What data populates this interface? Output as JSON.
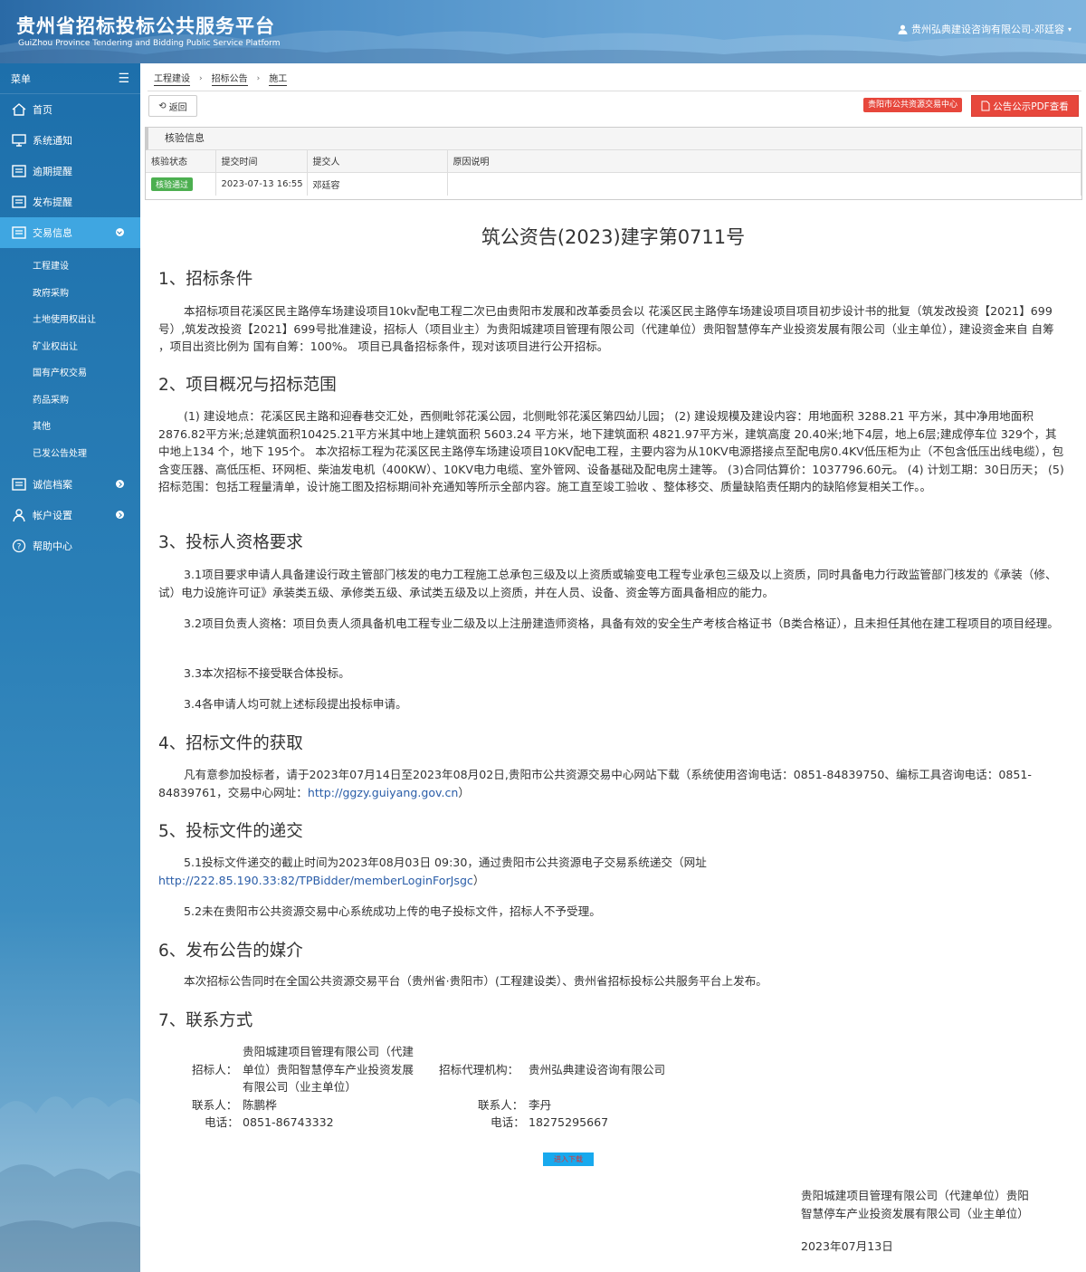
{
  "header": {
    "title": "贵州省招标投标公共服务平台",
    "subtitle": "GuiZhou Province Tendering and Bidding Public Service Platform",
    "user": "贵州弘典建设咨询有限公司-邓廷容"
  },
  "sidebar": {
    "menu_label": "菜单",
    "items": [
      {
        "label": "首页",
        "icon": "home-icon"
      },
      {
        "label": "系统通知",
        "icon": "monitor-icon"
      },
      {
        "label": "逾期提醒",
        "icon": "list-icon"
      },
      {
        "label": "发布提醒",
        "icon": "list-icon"
      },
      {
        "label": "交易信息",
        "icon": "list-icon"
      },
      {
        "label": "诚信档案",
        "icon": "list-icon"
      },
      {
        "label": "帐户设置",
        "icon": "user-icon"
      },
      {
        "label": "帮助中心",
        "icon": "help-icon"
      }
    ],
    "subitems": [
      "工程建设",
      "政府采购",
      "土地使用权出让",
      "矿业权出让",
      "国有产权交易",
      "药品采购",
      "其他",
      "已发公告处理"
    ]
  },
  "breadcrumb": [
    "工程建设",
    "招标公告",
    "施工"
  ],
  "toolbar": {
    "back_label": "返回",
    "center_badge": "贵阳市公共资源交易中心",
    "pdf_label": "公告公示PDF查看"
  },
  "verify": {
    "title": "核验信息",
    "headers": [
      "核验状态",
      "提交时间",
      "提交人",
      "原因说明"
    ],
    "status": "核验通过",
    "time": "2023-07-13 16:55",
    "submitter": "邓廷容",
    "reason": ""
  },
  "doc": {
    "title": "筑公资告(2023)建字第0711号",
    "s1_title": "1、招标条件",
    "s1_p": "本招标项目花溪区民主路停车场建设项目10kv配电工程二次已由贵阳市发展和改革委员会以 花溪区民主路停车场建设项目项目初步设计书的批复（筑发改投资【2021】699号）,筑发改投资【2021】699号批准建设，招标人（项目业主）为贵阳城建项目管理有限公司（代建单位）贵阳智慧停车产业投资发展有限公司（业主单位），建设资金来自 自筹 ，项目出资比例为 国有自筹：100%。 项目已具备招标条件，现对该项目进行公开招标。",
    "s2_title": "2、项目概况与招标范围",
    "s2_p": "(1) 建设地点：花溪区民主路和迎春巷交汇处，西侧毗邻花溪公园，北侧毗邻花溪区第四幼儿园； (2) 建设规模及建设内容：用地面积 3288.21 平方米，其中净用地面积2876.82平方米;总建筑面积10425.21平方米其中地上建筑面积 5603.24 平方米，地下建筑面积 4821.97平方米，建筑高度 20.40米;地下4层，地上6层;建成停车位 329个，其中地上134 个，地下 195个。 本次招标工程为花溪区民主路停车场建设项目10KV配电工程，主要内容为从10KV电源搭接点至配电房0.4KV低压柜为止（不包含低压出线电缆），包含变压器、高低压柜、环网柜、柴油发电机（400KW）、10KV电力电缆、室外管网、设备基础及配电房土建等。 (3)合同估算价：1037796.60元。 (4) 计划工期：30日历天； (5)招标范围：包括工程量清单，设计施工图及招标期间补充通知等所示全部内容。施工直至竣工验收 、整体移交、质量缺陷责任期内的缺陷修复相关工作。。",
    "s3_title": "3、投标人资格要求",
    "s3_p1": "3.1项目要求申请人具备建设行政主管部门核发的电力工程施工总承包三级及以上资质或输变电工程专业承包三级及以上资质，同时具备电力行政监管部门核发的《承装（修、试）电力设施许可证》承装类五级、承修类五级、承试类五级及以上资质，并在人员、设备、资金等方面具备相应的能力。",
    "s3_p2": "3.2项目负责人资格：项目负责人须具备机电工程专业二级及以上注册建造师资格，具备有效的安全生产考核合格证书（B类合格证），且未担任其他在建工程项目的项目经理。",
    "s3_p3": "3.3本次招标不接受联合体投标。",
    "s3_p4": "3.4各申请人均可就上述标段提出投标申请。",
    "s4_title": "4、招标文件的获取",
    "s4_p": "凡有意参加投标者，请于2023年07月14日至2023年08月02日,贵阳市公共资源交易中心网站下载（系统使用咨询电话：0851-84839750、编标工具咨询电话：0851-84839761，交易中心网址：",
    "s4_link": "http://ggzy.guiyang.gov.cn",
    "s4_tail": "）",
    "s5_title": "5、投标文件的递交",
    "s5_p1": "5.1投标文件递交的截止时间为2023年08月03日 09:30，通过贵阳市公共资源电子交易系统递交（网址",
    "s5_link": "http://222.85.190.33:82/TPBidder/memberLoginForJsgc",
    "s5_tail": "）",
    "s5_p2": "5.2未在贵阳市公共资源交易中心系统成功上传的电子投标文件，招标人不予受理。",
    "s6_title": "6、发布公告的媒介",
    "s6_p": "本次招标公告同时在全国公共资源交易平台（贵州省·贵阳市）(工程建设类）、贵州省招标投标公共服务平台上发布。",
    "s7_title": "7、联系方式",
    "c_tenderer_label": "招标人：",
    "c_tenderer_l1": "贵阳城建项目管理有限公司（代建",
    "c_tenderer_l2": "单位）贵阳智慧停车产业投资发展",
    "c_tenderer_l3": "有限公司（业主单位）",
    "c_agent_label": "招标代理机构：",
    "c_agent": "贵州弘典建设咨询有限公司",
    "c_contact_label": "联系人：",
    "c_contact1": "陈鹏桦",
    "c_contact2": "李丹",
    "c_phone_label": "电话：",
    "c_phone1": "0851-86743332",
    "c_phone2": "18275295667",
    "download_label": "进入下载",
    "sign_l1": "贵阳城建项目管理有限公司（代建单位）贵阳",
    "sign_l2": "智慧停车产业投资发展有限公司（业主单位）",
    "sign_date": "2023年07月13日"
  }
}
